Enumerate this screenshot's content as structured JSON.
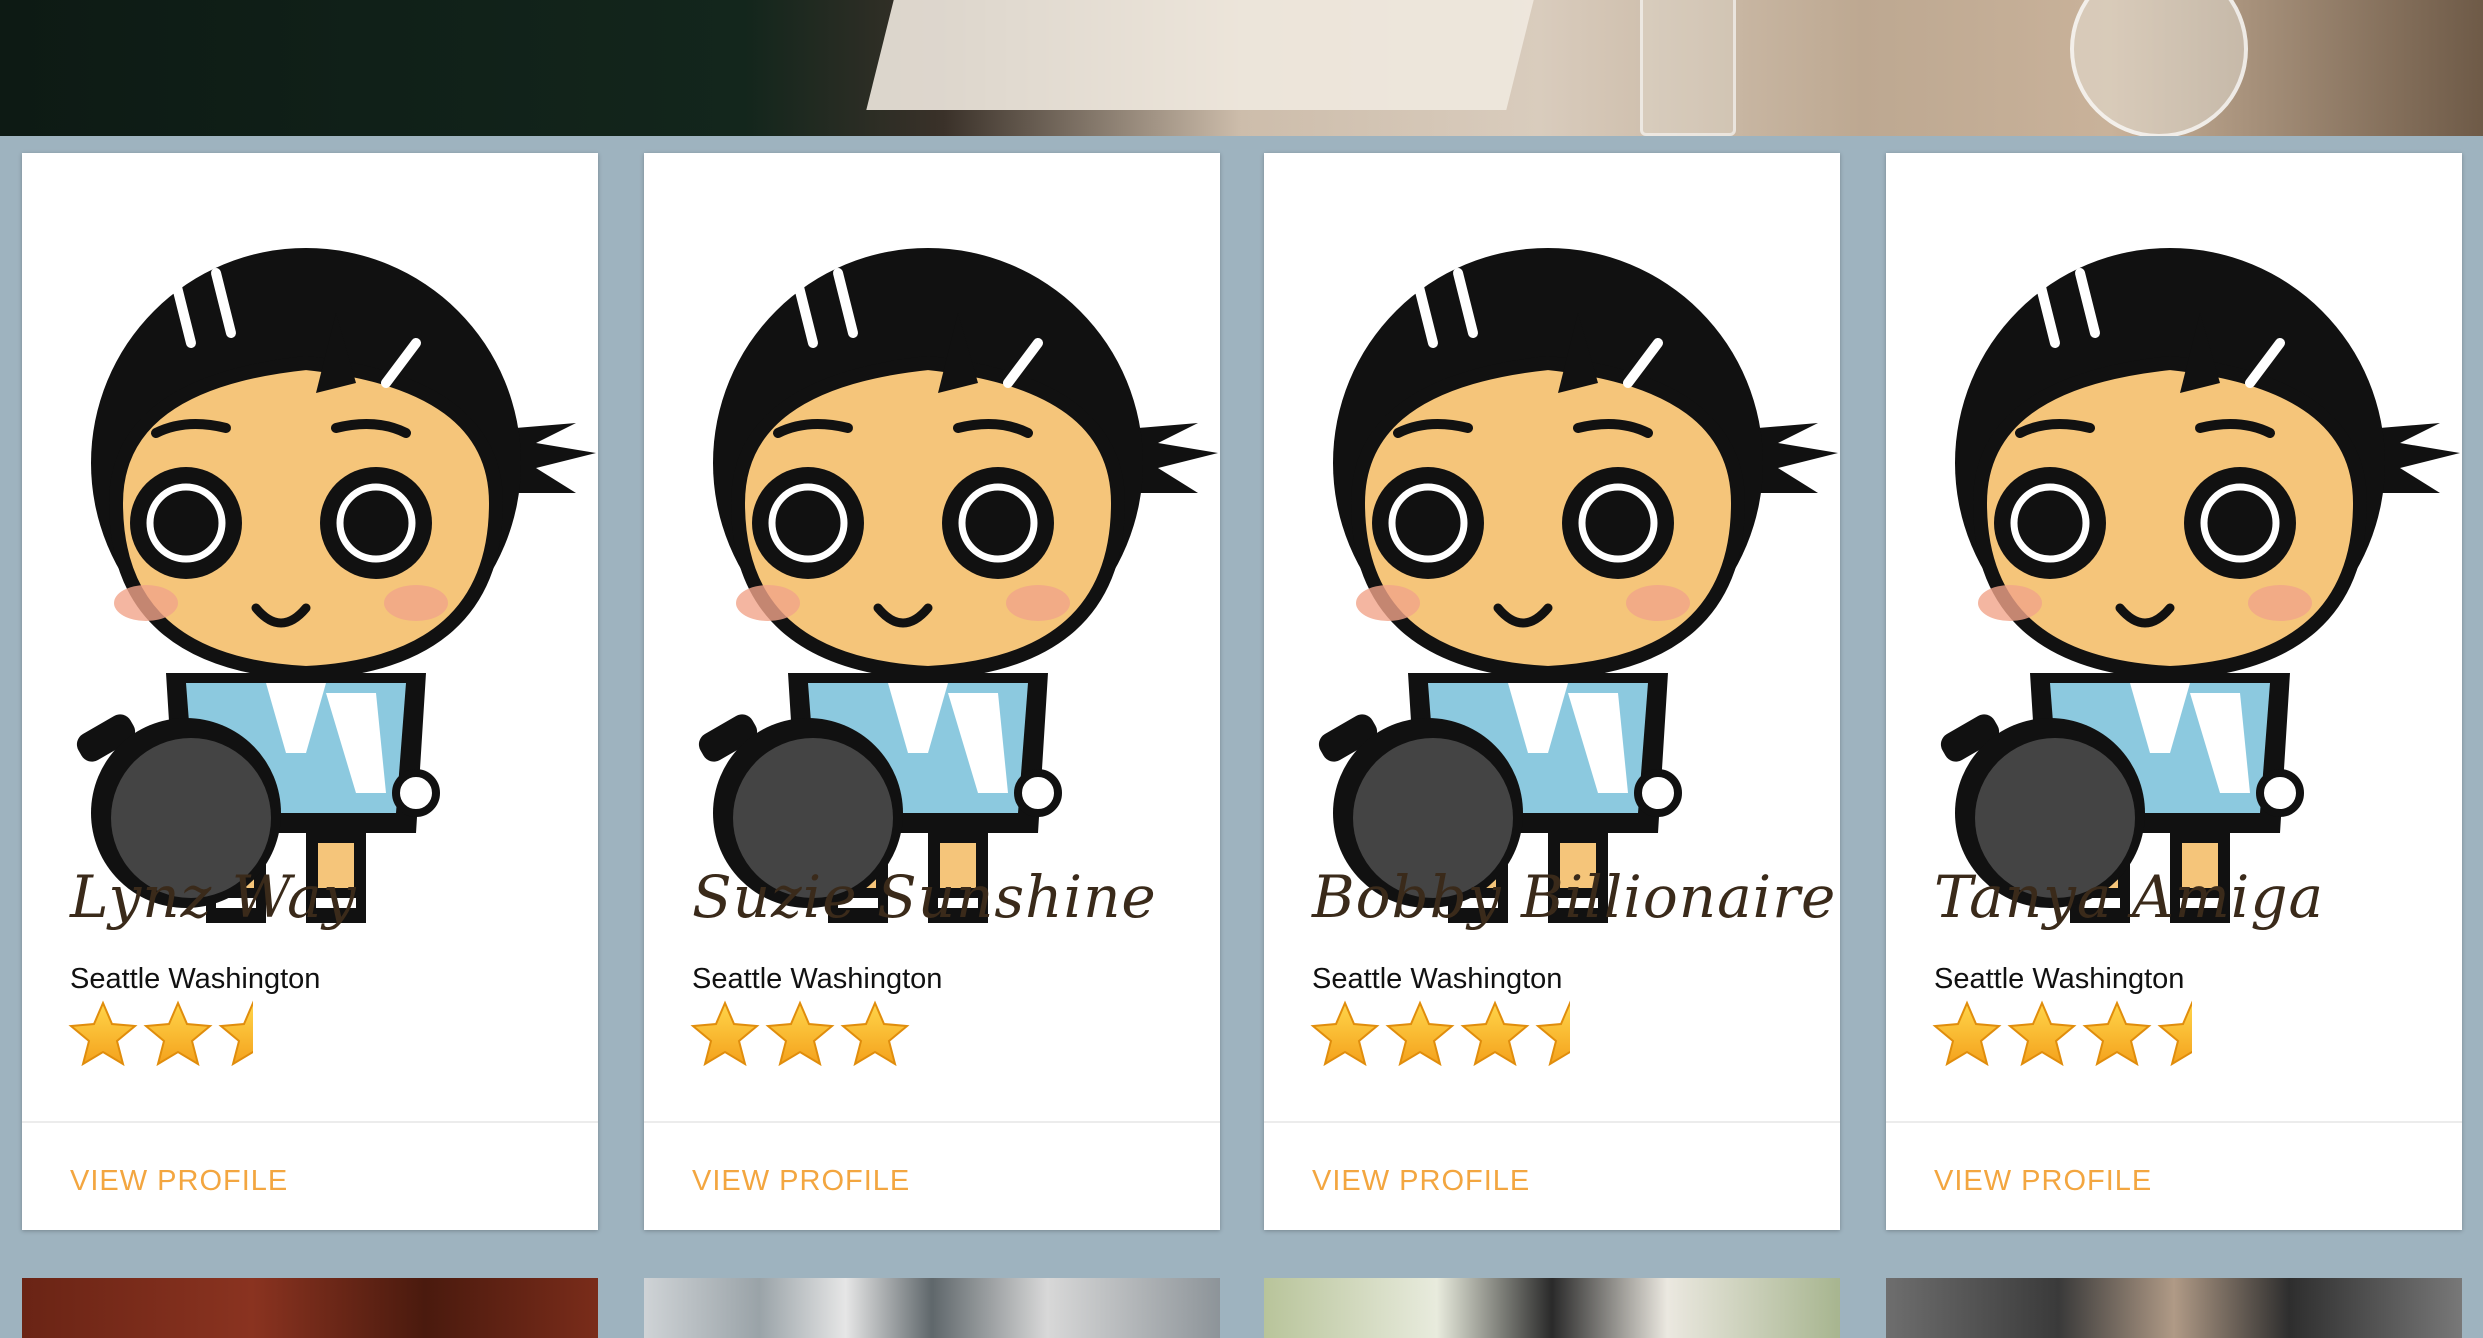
{
  "colors": {
    "background": "#9eb3bf",
    "accent": "#f3a640",
    "name_color": "#3a2a1a"
  },
  "profiles": [
    {
      "name": "Lynz Way",
      "location": "Seattle Washington",
      "rating": 2.5,
      "action": "VIEW PROFILE",
      "avatar_icon": "table-tennis-player-avatar"
    },
    {
      "name": "Suzie Sunshine",
      "location": "Seattle Washington",
      "rating": 3,
      "action": "VIEW PROFILE",
      "avatar_icon": "table-tennis-player-avatar"
    },
    {
      "name": "Bobby Billionaire",
      "location": "Seattle Washington",
      "rating": 3.5,
      "action": "VIEW PROFILE",
      "avatar_icon": "table-tennis-player-avatar"
    },
    {
      "name": "Tanya Amiga",
      "location": "Seattle Washington",
      "rating": 3.5,
      "action": "VIEW PROFILE",
      "avatar_icon": "table-tennis-player-avatar"
    }
  ]
}
